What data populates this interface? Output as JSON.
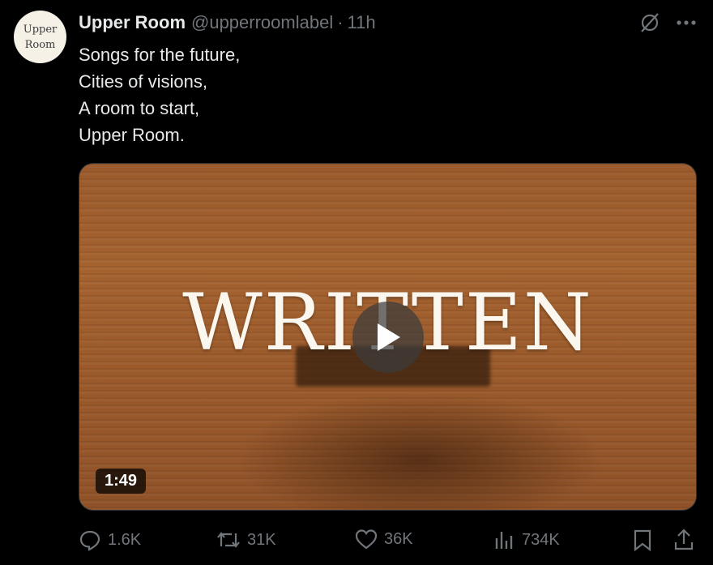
{
  "avatar": {
    "line1": "Upper",
    "line2": "Room"
  },
  "author": {
    "name": "Upper Room",
    "handle": "@upperroomlabel",
    "separator": "·",
    "time": "11h"
  },
  "tweet": {
    "lines": [
      "Songs for the future,",
      "Cities of visions,",
      "A room to start,",
      "Upper Room."
    ]
  },
  "media": {
    "overlay_text": "WRITTEN",
    "duration": "1:49"
  },
  "actions": {
    "replies": "1.6K",
    "reposts": "31K",
    "likes": "36K",
    "views": "734K"
  },
  "icons": {
    "top": [
      "grok-icon",
      "more-icon"
    ],
    "bottom": [
      "reply-icon",
      "repost-icon",
      "like-icon",
      "views-icon",
      "bookmark-icon",
      "share-icon"
    ]
  },
  "colors": {
    "background": "#000000",
    "text": "#e7e9ea",
    "muted": "#71767b"
  }
}
